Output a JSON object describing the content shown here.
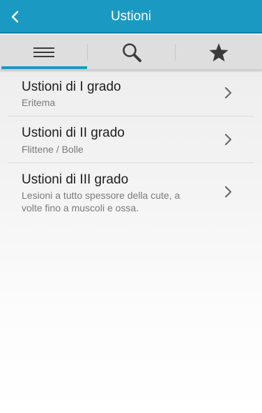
{
  "header": {
    "title": "Ustioni",
    "back_icon": "chevron-left-icon",
    "color": "#1a9ac3"
  },
  "tabs": [
    {
      "icon": "menu-icon",
      "selected": true
    },
    {
      "icon": "search-icon",
      "selected": false
    },
    {
      "icon": "star-icon",
      "selected": false
    }
  ],
  "list": {
    "items": [
      {
        "title": "Ustioni di I grado",
        "subtitle": "Eritema"
      },
      {
        "title": "Ustioni di II grado",
        "subtitle": "Flittene / Bolle"
      },
      {
        "title": "Ustioni di III grado",
        "subtitle": "Lesioni a tutto spessore della cute, a volte fino a muscoli e ossa."
      }
    ]
  }
}
